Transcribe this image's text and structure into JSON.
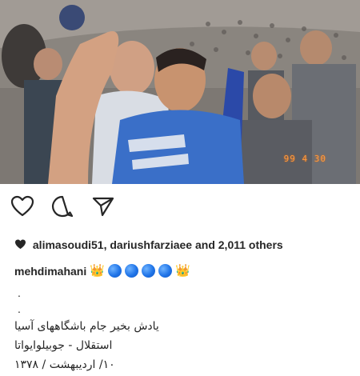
{
  "photo": {
    "date_stamp": "99 4 30"
  },
  "actions": {
    "like_icon": "heart-outline-icon",
    "comment_icon": "comment-bubble-icon",
    "share_icon": "send-paper-plane-icon"
  },
  "likes": {
    "liked_by": "alimasoudi51, dariushfarziaee",
    "and_text": "and 2,011 others"
  },
  "caption": {
    "username": "mehdimahani",
    "emoji_sequence": [
      "crown",
      "blue-circle",
      "blue-circle",
      "blue-circle",
      "blue-circle",
      "crown"
    ],
    "dot_1": ".",
    "dot_2": ".",
    "line_1": "یادش بخیر جام باشگاههای آسیا",
    "line_2": "استقلال - جوبیلوایواتا",
    "line_3": "۱۰/ اردیبهشت / ۱۳۷۸"
  },
  "colors": {
    "text": "#262626",
    "crown": "#f5b400",
    "blue_circle": "#1f74e8",
    "date_stamp": "#ff9a3c"
  }
}
